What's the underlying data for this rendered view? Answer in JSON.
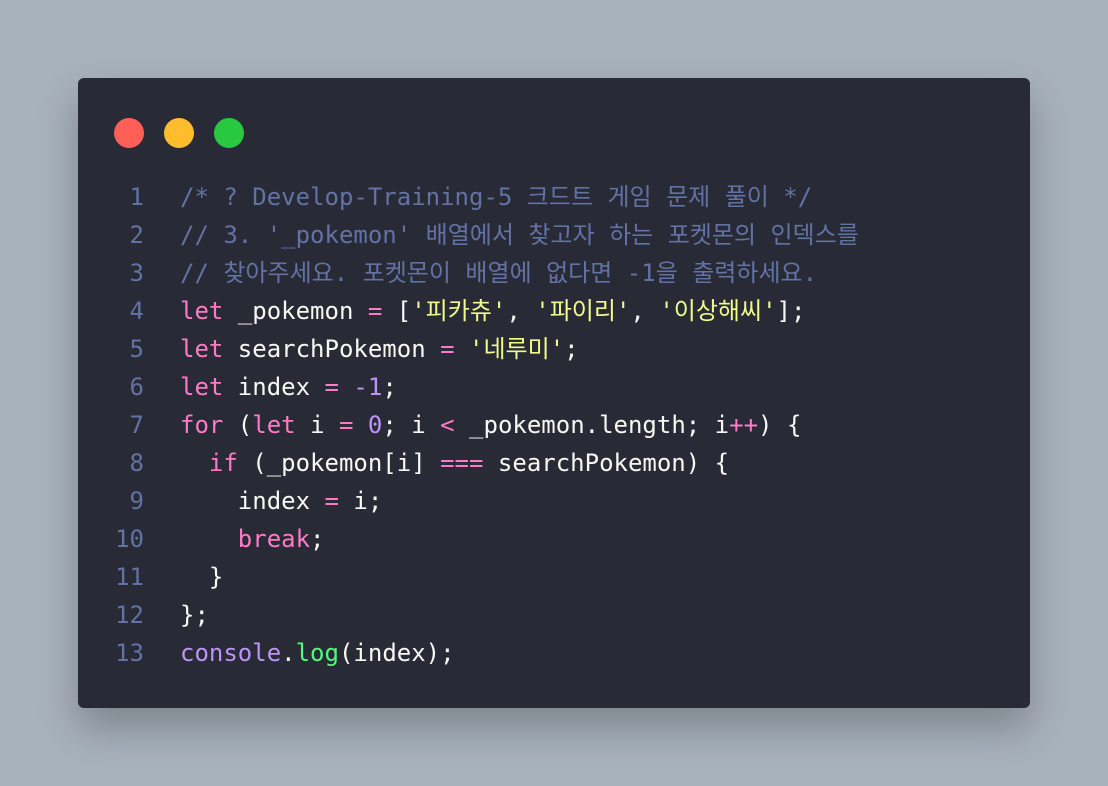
{
  "window": {
    "controls": [
      {
        "name": "close",
        "color": "#ff5f57"
      },
      {
        "name": "minimize",
        "color": "#ffbd2e"
      },
      {
        "name": "maximize",
        "color": "#28c840"
      }
    ]
  },
  "code_lines": [
    {
      "number": "1",
      "tokens": [
        {
          "t": "/* ? Develop-Training-5 크드트 게임 문제 풀이 */",
          "k": "comment"
        }
      ]
    },
    {
      "number": "2",
      "tokens": [
        {
          "t": "// 3. '_pokemon' 배열에서 찾고자 하는 포켓몬의 인덱스를",
          "k": "comment"
        }
      ]
    },
    {
      "number": "3",
      "tokens": [
        {
          "t": "// 찾아주세요. 포켓몬이 배열에 없다면 -1을 출력하세요.",
          "k": "comment"
        }
      ]
    },
    {
      "number": "4",
      "tokens": [
        {
          "t": "let",
          "k": "keyword"
        },
        {
          "t": " _pokemon ",
          "k": "plain"
        },
        {
          "t": "=",
          "k": "op"
        },
        {
          "t": " [",
          "k": "plain"
        },
        {
          "t": "'피카츄'",
          "k": "string"
        },
        {
          "t": ", ",
          "k": "plain"
        },
        {
          "t": "'파이리'",
          "k": "string"
        },
        {
          "t": ", ",
          "k": "plain"
        },
        {
          "t": "'이상해씨'",
          "k": "string"
        },
        {
          "t": "];",
          "k": "plain"
        }
      ]
    },
    {
      "number": "5",
      "tokens": [
        {
          "t": "let",
          "k": "keyword"
        },
        {
          "t": " searchPokemon ",
          "k": "plain"
        },
        {
          "t": "=",
          "k": "op"
        },
        {
          "t": " ",
          "k": "plain"
        },
        {
          "t": "'네루미'",
          "k": "string"
        },
        {
          "t": ";",
          "k": "plain"
        }
      ]
    },
    {
      "number": "6",
      "tokens": [
        {
          "t": "let",
          "k": "keyword"
        },
        {
          "t": " index ",
          "k": "plain"
        },
        {
          "t": "=",
          "k": "op"
        },
        {
          "t": " ",
          "k": "plain"
        },
        {
          "t": "-1",
          "k": "number"
        },
        {
          "t": ";",
          "k": "plain"
        }
      ]
    },
    {
      "number": "7",
      "tokens": [
        {
          "t": "for",
          "k": "keyword"
        },
        {
          "t": " (",
          "k": "plain"
        },
        {
          "t": "let",
          "k": "keyword"
        },
        {
          "t": " i ",
          "k": "plain"
        },
        {
          "t": "=",
          "k": "op"
        },
        {
          "t": " ",
          "k": "plain"
        },
        {
          "t": "0",
          "k": "number"
        },
        {
          "t": "; i ",
          "k": "plain"
        },
        {
          "t": "<",
          "k": "op"
        },
        {
          "t": " _pokemon.length; i",
          "k": "plain"
        },
        {
          "t": "++",
          "k": "op"
        },
        {
          "t": ") {",
          "k": "plain"
        }
      ]
    },
    {
      "number": "8",
      "tokens": [
        {
          "t": "  ",
          "k": "plain"
        },
        {
          "t": "if",
          "k": "keyword"
        },
        {
          "t": " (_pokemon[i] ",
          "k": "plain"
        },
        {
          "t": "===",
          "k": "op"
        },
        {
          "t": " searchPokemon) {",
          "k": "plain"
        }
      ]
    },
    {
      "number": "9",
      "tokens": [
        {
          "t": "    index ",
          "k": "plain"
        },
        {
          "t": "=",
          "k": "op"
        },
        {
          "t": " i;",
          "k": "plain"
        }
      ]
    },
    {
      "number": "10",
      "tokens": [
        {
          "t": "    ",
          "k": "plain"
        },
        {
          "t": "break",
          "k": "keyword"
        },
        {
          "t": ";",
          "k": "plain"
        }
      ]
    },
    {
      "number": "11",
      "tokens": [
        {
          "t": "  }",
          "k": "plain"
        }
      ]
    },
    {
      "number": "12",
      "tokens": [
        {
          "t": "};",
          "k": "plain"
        }
      ]
    },
    {
      "number": "13",
      "tokens": [
        {
          "t": "console",
          "k": "builtin"
        },
        {
          "t": ".",
          "k": "plain"
        },
        {
          "t": "log",
          "k": "func"
        },
        {
          "t": "(index);",
          "k": "plain"
        }
      ]
    }
  ]
}
